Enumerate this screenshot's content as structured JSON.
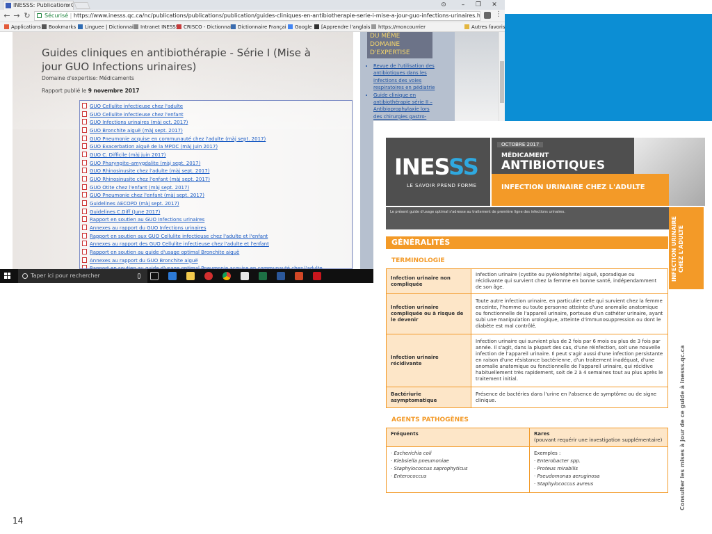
{
  "browser": {
    "tab_title": "INESSS: Publication: Guid",
    "tab_close": "×",
    "window_controls": [
      "–",
      "❐",
      "✕"
    ],
    "profile_icon": "⊙",
    "secure_label": "Sécurisé",
    "url": "https://www.inesss.qc.ca/nc/publications/publications/publication/guides-cliniques-en-antibiotherapie-serie-i-mise-a-jour-guo-infections-urinaires.html",
    "bookmarks": [
      {
        "label": "Applications",
        "color": "#e35b3a"
      },
      {
        "label": "Bookmarks",
        "color": "#555555"
      },
      {
        "label": "Linguee | Dictionnai",
        "color": "#2f6cb3"
      },
      {
        "label": "Intranet INESSS",
        "color": "#888888"
      },
      {
        "label": "CRISCO - Dictionnai",
        "color": "#c73c3c"
      },
      {
        "label": "Dictionnaire Françai",
        "color": "#3b6db0"
      },
      {
        "label": "Google",
        "color": "#4285f4"
      },
      {
        "label": "[Apprendre l'anglais",
        "color": "#333333"
      },
      {
        "label": "https://moncourrier",
        "color": "#999999"
      },
      {
        "label": "Autres favoris",
        "color": "#e3b640"
      }
    ]
  },
  "page": {
    "title": "Guides cliniques en antibiothérapie - Série I (Mise à jour GUO Infections urinaires)",
    "domain": "Domaine d'expertise: Médicaments",
    "report_prefix": "Rapport publié le",
    "report_date": "9 novembre 2017",
    "links": [
      "GUO Cellulite infectieuse chez l'adulte",
      "GUO Cellulite infectieuse chez l'enfant",
      "GUO Infections urinaires (màj oct. 2017)",
      "GUO Bronchite aiguë (màj sept. 2017)",
      "GUO Pneumonie acquise en communauté chez l'adulte (màj sept. 2017)",
      "GUO Exacerbation aiguë de la MPOC (màj juin 2017)",
      "GUO C. Difficile (màj juin 2017)",
      "GUO Pharyngite–amygdalite (màj sept. 2017)",
      "GUO Rhinosinusite chez l'adulte (màj sept. 2017)",
      "GUO Rhinosinusite chez l'enfant (màj sept. 2017)",
      "GUO Otite chez l'enfant (màj sept. 2017)",
      "GUO Pneumonie chez l'enfant (màj sept. 2017)",
      "Guidelines AECOPD (màj sept. 2017)",
      "Guidelines C.Diff (June 2017)",
      "Rapport en soutien au GUO Infections urinaires",
      "Annexes au rapport du GUO Infections urinaires",
      "Rapport en soutien aux GUO Cellulite infectieuse chez l'adulte et l'enfant",
      "Annexes au rapport des GUO Cellulite infectieuse chez l'adulte et l'enfant",
      "Rapport en soutien au guide d'usage optimal Bronchite aiguë",
      "Annexes au rapport du GUO Bronchite aiguë",
      "Rapport en soutien au guide d'usage optimal Pneumonie acquise en communauté chez l'adulte"
    ],
    "sidebar_heading": [
      "DU MÊME",
      "DOMAINE",
      "D'EXPERTISE"
    ],
    "sidebar_links": [
      "Revue de l'utilisation des antibiotiques dans les infections des voies respiratoires en pédiatrie",
      "Guide clinique en antibiothérapie série II – Antibioprophylaxie lors des chirurgies gastro-intestinales"
    ]
  },
  "taskbar": {
    "search_placeholder": "Taper ici pour rechercher",
    "apps": [
      "task-view-icon",
      "edge-icon",
      "file-explorer-icon",
      "app-red-icon",
      "chrome-icon",
      "store-icon",
      "excel-icon",
      "word-icon",
      "powerpoint-icon",
      "acrobat-icon"
    ]
  },
  "document": {
    "logo_main": "INES",
    "logo_s": "SS",
    "tagline": "LE SAVOIR PREND FORME",
    "date": "OCTOBRE 2017",
    "subtitle1": "MÉDICAMENT",
    "subtitle2": "ANTIBIOTIQUES",
    "topic": "INFECTION URINAIRE CHEZ L'ADULTE",
    "intro": "Le présent guide d'usage optimal s'adresse au traitement de première ligne des infections urinaires.",
    "section_generalites": "GÉNÉRALITÉS",
    "terminologie": "TERMINOLOGIE",
    "terms": [
      {
        "term": "Infection urinaire non compliquée",
        "def": "Infection urinaire (cystite ou pyélonéphrite) aiguë, sporadique ou récidivante qui survient chez la femme en bonne santé, indépendamment de son âge."
      },
      {
        "term": "Infection urinaire compliquée ou à risque de le devenir",
        "def": "Toute autre infection urinaire, en particulier celle qui survient chez la femme enceinte, l'homme ou toute personne atteinte d'une anomalie anatomique ou fonctionnelle de l'appareil urinaire, porteuse d'un cathéter urinaire, ayant subi une manipulation urologique, atteinte d'immunosuppression ou dont le diabète est mal contrôlé."
      },
      {
        "term": "Infection urinaire récidivante",
        "def": "Infection urinaire qui survient plus de 2 fois par 6 mois ou plus de 3 fois par année. Il s'agit, dans la plupart des cas, d'une réinfection, soit une nouvelle infection de l'appareil urinaire. Il peut s'agir aussi d'une infection persistante en raison d'une résistance bactérienne, d'un traitement inadéquat, d'une anomalie anatomique ou fonctionnelle de l'appareil urinaire, qui récidive habituellement très rapidement, soit de 2 à 4 semaines tout au plus après le traitement initial."
      },
      {
        "term": "Bactériurie asymptomatique",
        "def": "Présence de bactéries dans l'urine en l'absence de symptôme ou de signe clinique."
      }
    ],
    "agents": "AGENTS PATHOGÈNES",
    "col_frequent": "Fréquents",
    "col_rare": "Rares",
    "col_rare_note": "(pouvant requérir une investigation supplémentaire)",
    "frequent": [
      "Escherichia coli",
      "Klebsiella pneumoniae",
      "Staphylococcus saprophyticus",
      "Enterococcus"
    ],
    "rare_prefix": "Exemples :",
    "rare": [
      "Enterobacter spp.",
      "Proteus mirabilis",
      "Pseudomonas aeruginosa",
      "Staphylococcus aureus"
    ],
    "side_tab": "INFECTION URINAIRE CHEZ L'ADULTE",
    "vertical_note": "Consulter les mises à jour de ce guide à inesss.qc.ca"
  },
  "slide": {
    "page_number": "14"
  }
}
